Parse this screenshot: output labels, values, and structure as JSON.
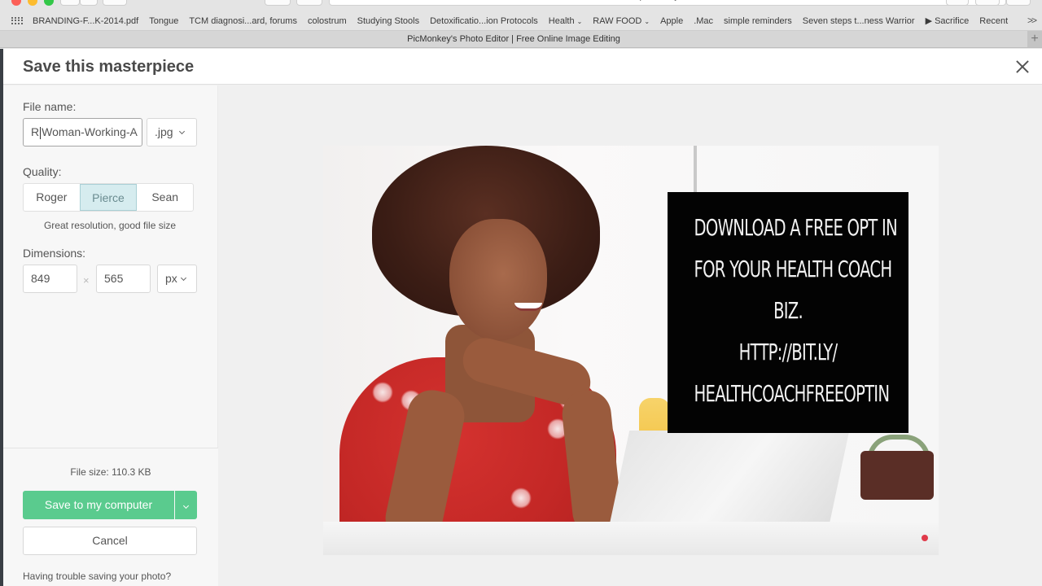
{
  "browser": {
    "url": "picmonkey.com",
    "tab_title": "PicMonkey's Photo Editor | Free Online Image Editing",
    "bookmarks": [
      {
        "label": "BRANDING-F...K-2014.pdf",
        "has_menu": false
      },
      {
        "label": "Tongue",
        "has_menu": false
      },
      {
        "label": "TCM diagnosi...ard, forums",
        "has_menu": false
      },
      {
        "label": "colostrum",
        "has_menu": false
      },
      {
        "label": "Studying Stools",
        "has_menu": false
      },
      {
        "label": "Detoxificatio...ion Protocols",
        "has_menu": false
      },
      {
        "label": "Health",
        "has_menu": true
      },
      {
        "label": "RAW FOOD",
        "has_menu": true
      },
      {
        "label": "Apple",
        "has_menu": false
      },
      {
        "label": ".Mac",
        "has_menu": false
      },
      {
        "label": "simple reminders",
        "has_menu": false
      },
      {
        "label": "Seven steps t...ness Warrior",
        "has_menu": false
      },
      {
        "label": "▶ Sacrifice",
        "has_menu": false
      },
      {
        "label": "Recent",
        "has_menu": false
      }
    ],
    "more_label": ">>",
    "new_tab_label": "+"
  },
  "dialog": {
    "title": "Save this masterpiece",
    "file_name_label": "File name:",
    "file_name_value": "Woman-Working-A",
    "file_name_prefix": "R",
    "format_value": ".jpg",
    "quality_label": "Quality:",
    "quality_options": [
      {
        "label": "Roger",
        "selected": false
      },
      {
        "label": "Pierce",
        "selected": true
      },
      {
        "label": "Sean",
        "selected": false
      }
    ],
    "quality_description": "Great resolution, good file size",
    "dimensions_label": "Dimensions:",
    "width_value": "849",
    "height_value": "565",
    "dimension_separator": "×",
    "unit_value": "px",
    "file_size": "File size: 110.3 KB",
    "save_label": "Save to my computer",
    "cancel_label": "Cancel",
    "trouble_text": "Having trouble saving your photo?"
  },
  "preview": {
    "overlay_lines": [
      "DOWNLOAD A FREE OPT IN",
      "FOR YOUR HEALTH COACH",
      "BIZ.",
      "HTTP://BIT.LY/",
      "HEALTHCOACHFREEOPTIN"
    ]
  },
  "colors": {
    "save_button": "#5acb8e",
    "quality_selected_bg": "#d6ecef",
    "overlay_bg": "#030303"
  }
}
